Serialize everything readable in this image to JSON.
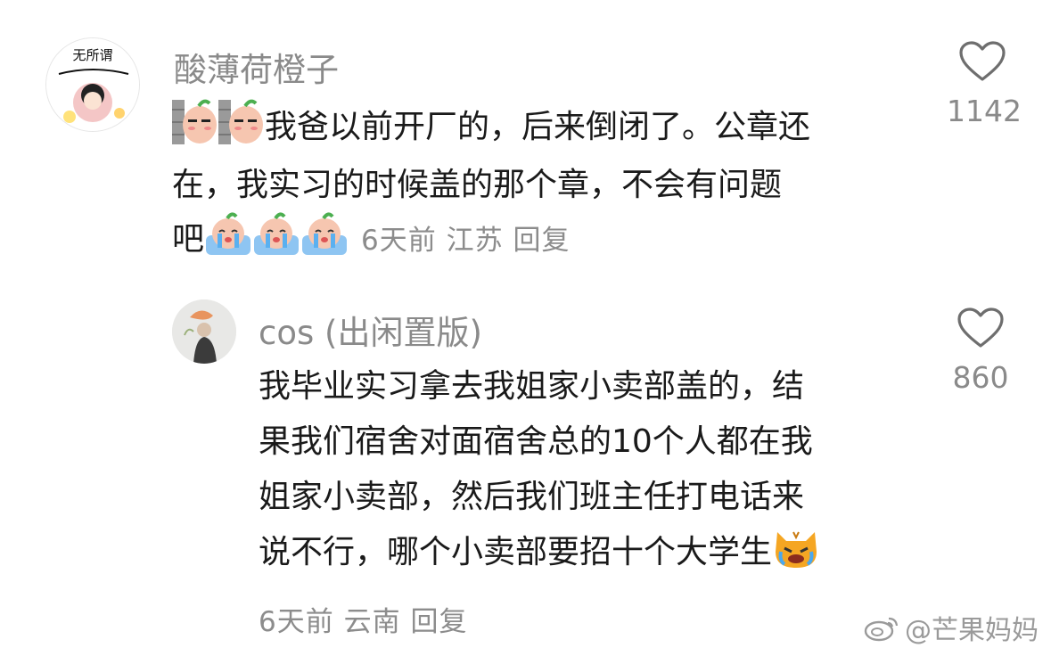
{
  "comment1": {
    "avatar_caption": "无所谓",
    "username": "酸薄荷橙子",
    "lines": [
      "我爸以前开厂的，后来倒闭了。公章还",
      "在，我实习的时候盖的那个章，不会有问题",
      "吧"
    ],
    "time": "6天前",
    "location": "江苏",
    "reply_label": "回复",
    "like_count": "1142"
  },
  "comment2": {
    "username": "cos (出闲置版)",
    "lines": [
      "我毕业实习拿去我姐家小卖部盖的，结",
      "果我们宿舍对面宿舍总的10个人都在我",
      "姐家小卖部，然后我们班主任打电话来",
      "说不行，哪个小卖部要招十个大学生"
    ],
    "time": "6天前",
    "location": "云南",
    "reply_label": "回复",
    "like_count": "860"
  },
  "watermark": "@芒果妈妈",
  "icons": {
    "like": "heart-outline-icon",
    "emoji_thinking": "thinking-wall-emoji",
    "emoji_cry": "crying-emoji",
    "emoji_cat": "crying-cat-emoji",
    "weibo": "weibo-logo-icon"
  }
}
